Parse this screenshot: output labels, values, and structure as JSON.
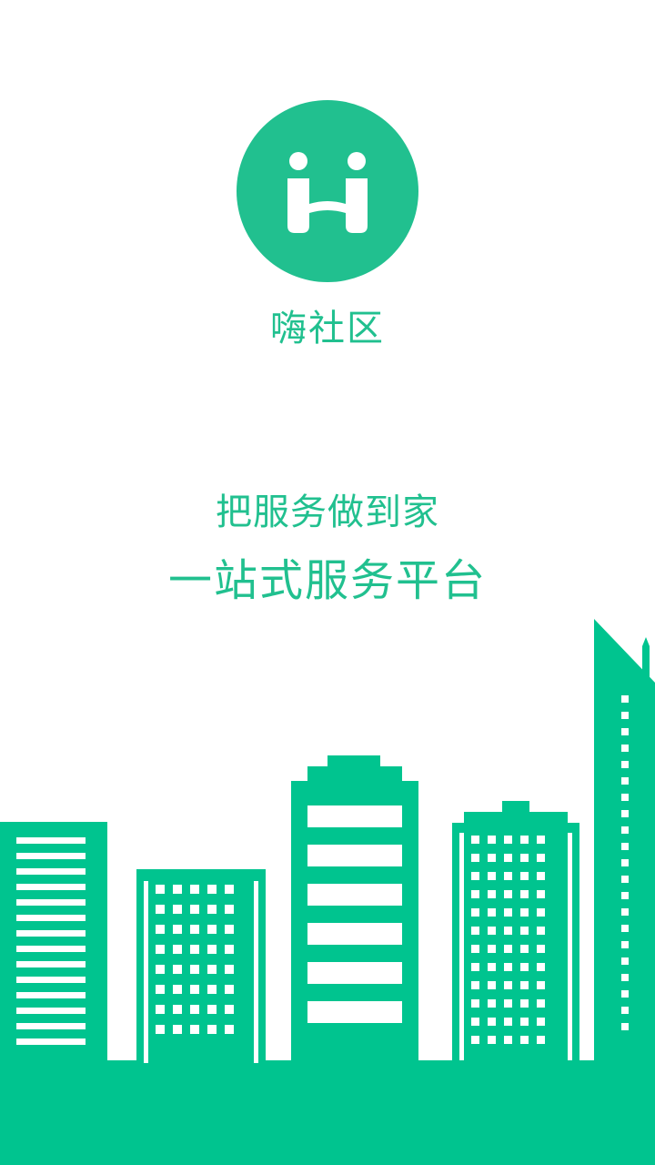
{
  "app": {
    "name": "嗨社区",
    "slogan_line1": "把服务做到家",
    "slogan_line2": "一站式服务平台"
  },
  "colors": {
    "brand_green": "#21c08f",
    "background": "#ffffff"
  },
  "icons": {
    "logo": "hi-logo-icon",
    "illustration": "city-skyline-illustration"
  }
}
